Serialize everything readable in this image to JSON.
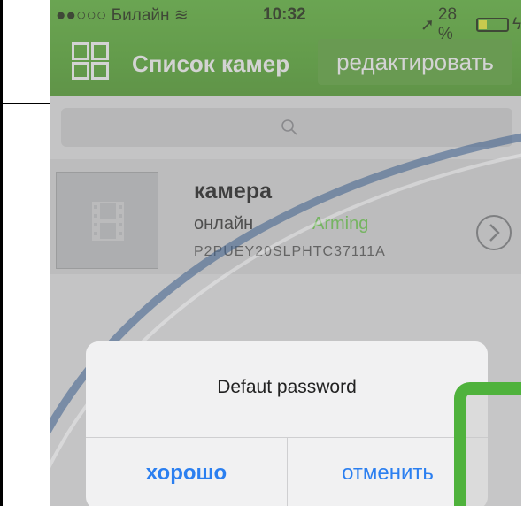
{
  "statusbar": {
    "carrier": "●●○○○ Билайн",
    "time": "10:32",
    "battery": "28 %",
    "battery_level": 0.28
  },
  "navbar": {
    "title": "Список камер",
    "edit_label": "редактировать"
  },
  "camera": {
    "name": "камера",
    "status": "онлайн",
    "mode": "Arming",
    "id": "P2PUEY20SLPHTC37111A"
  },
  "alert": {
    "message": "Defaut password",
    "ok_label": "хорошо",
    "cancel_label": "отменить"
  },
  "colors": {
    "navbar_green": "#57ad31",
    "link_blue": "#2b7ff0",
    "arming_green": "#6fcf50"
  }
}
